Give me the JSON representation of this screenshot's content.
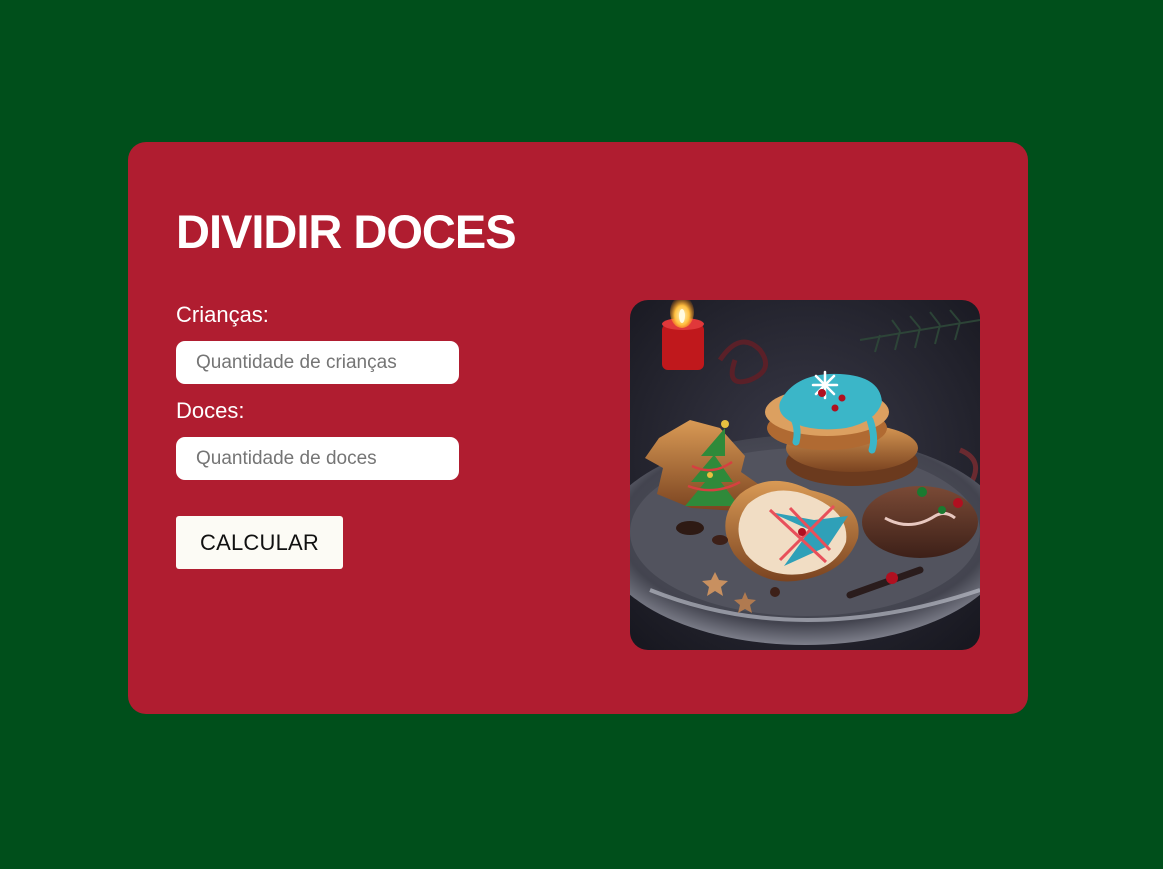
{
  "form": {
    "title": "DIVIDIR DOCES",
    "kids_label": "Crianças:",
    "kids_placeholder": "Quantidade de crianças",
    "candy_label": "Doces:",
    "candy_placeholder": "Quantidade de doces",
    "button_label": "CALCULAR"
  },
  "colors": {
    "background": "#004f1b",
    "card": "#b01d30",
    "button": "#fcfbf5"
  },
  "image": {
    "subject": "plate-of-decorated-christmas-cookies-icon"
  }
}
